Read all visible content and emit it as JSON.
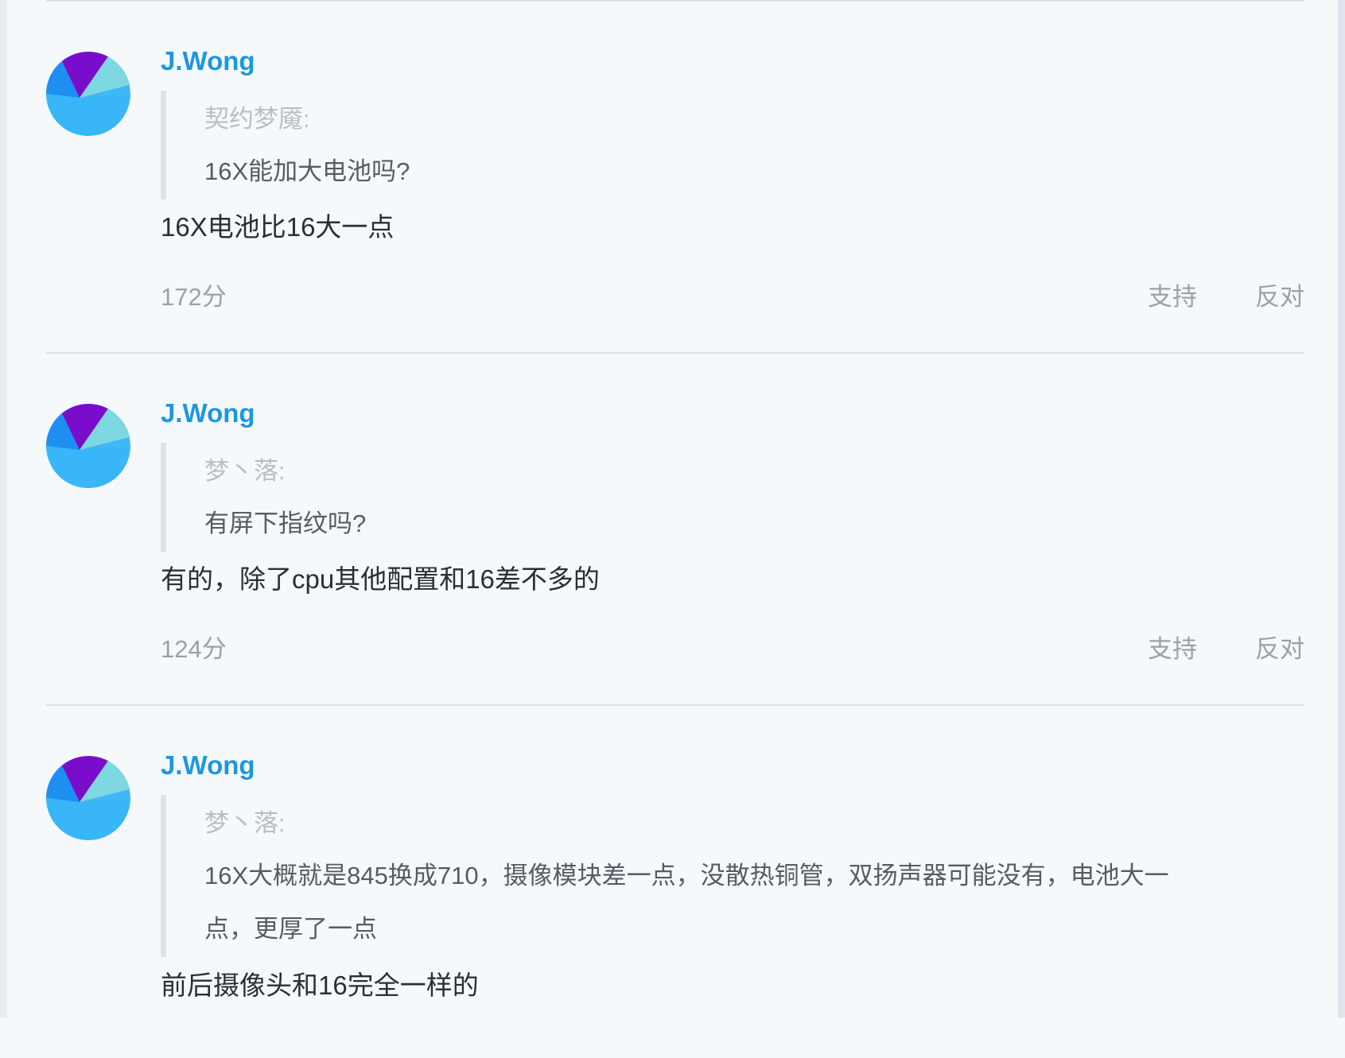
{
  "colors": {
    "page_background": "#f5f9fc",
    "username": "#1f96e0",
    "divider": "#d9e1e9",
    "quote_bar": "#dee3e8",
    "muted_text": "#9aa1a8",
    "quote_author": "#b9bec3"
  },
  "avatar_icon": "gradient-pie-avatar",
  "comments": [
    {
      "username": "J.Wong",
      "quote_author": "契约梦魇:",
      "quote_lines": [
        "16X能加大电池吗?"
      ],
      "reply": "16X电池比16大一点",
      "score": "172分",
      "support_label": "支持",
      "oppose_label": "反对"
    },
    {
      "username": "J.Wong",
      "quote_author": "梦丶落:",
      "quote_lines": [
        "有屏下指纹吗?"
      ],
      "reply": "有的，除了cpu其他配置和16差不多的",
      "score": "124分",
      "support_label": "支持",
      "oppose_label": "反对"
    },
    {
      "username": "J.Wong",
      "quote_author": "梦丶落:",
      "quote_lines": [
        "16X大概就是845换成710，摄像模块差一点，没散热铜管，双扬声器可能没有，电池大一",
        "点，更厚了一点"
      ],
      "reply": "前后摄像头和16完全一样的"
    }
  ]
}
